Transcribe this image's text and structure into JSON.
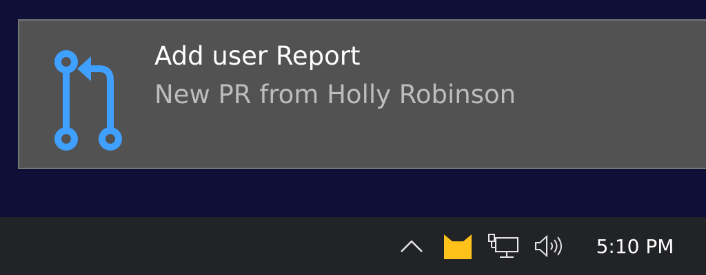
{
  "notification": {
    "title": "Add user Report",
    "body": "New PR from Holly Robinson",
    "icon": "pull-request-icon",
    "icon_color": "#3fa0ff"
  },
  "taskbar": {
    "tray_icons": [
      "chevron-up-icon",
      "cat-app-icon",
      "network-icon",
      "volume-icon"
    ],
    "clock": "5:10 PM",
    "cat_color": "#ffc21a"
  },
  "colors": {
    "desktop": "#0f1038",
    "toast_bg": "#525252",
    "taskbar_bg": "#222326"
  }
}
